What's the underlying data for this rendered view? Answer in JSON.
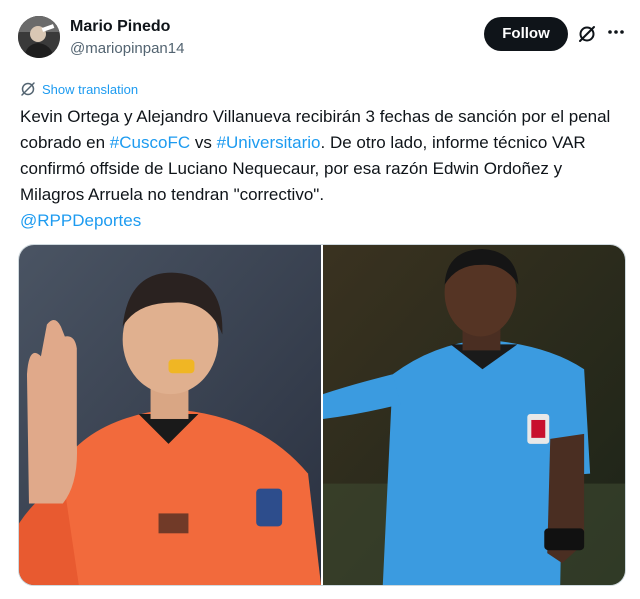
{
  "author": {
    "name": "Mario Pinedo",
    "handle": "@mariopinpan14"
  },
  "actions": {
    "follow_label": "Follow"
  },
  "translate": {
    "label": "Show translation"
  },
  "tweet": {
    "segments": [
      {
        "text": "Kevin Ortega y Alejandro Villanueva recibirán 3 fechas de sanción por el penal cobrado en ",
        "link": false
      },
      {
        "text": "#CuscoFC",
        "link": true
      },
      {
        "text": " vs ",
        "link": false
      },
      {
        "text": "#Universitario",
        "link": true
      },
      {
        "text": ". De otro lado, informe técnico VAR confirmó offside de Luciano Nequecaur, por esa razón Edwin Ordoñez y Milagros Arruela no tendran \"correctivo\".",
        "link": false
      },
      {
        "text": " ",
        "link": false
      },
      {
        "text": "@RPPDeportes",
        "link": true
      }
    ]
  },
  "media": {
    "photos": [
      {
        "icon": "referee-orange-photo"
      },
      {
        "icon": "referee-blue-photo"
      }
    ]
  },
  "colors": {
    "link": "#1d9bf0",
    "follow_bg": "#0f1419",
    "text": "#0f1419",
    "muted": "#536471"
  }
}
